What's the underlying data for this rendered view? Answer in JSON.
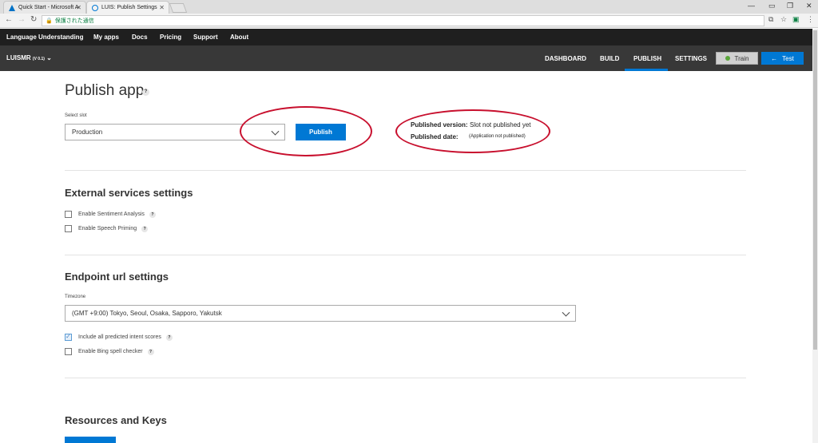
{
  "browser": {
    "tabs": [
      {
        "title": "Quick Start - Microsoft A",
        "active": false
      },
      {
        "title": "LUIS: Publish Settings",
        "active": true
      }
    ],
    "address": {
      "secure_label": "保護された通信",
      "url": ""
    }
  },
  "topnav": {
    "brand": "Language Understanding",
    "items": [
      "My apps",
      "Docs",
      "Pricing",
      "Support",
      "About"
    ]
  },
  "appbar": {
    "app_name": "LUISMR",
    "version": "(V 0.1)",
    "nav": [
      "DASHBOARD",
      "BUILD",
      "PUBLISH",
      "SETTINGS"
    ],
    "active_nav": "PUBLISH",
    "train_label": "Train",
    "test_label": "Test",
    "accent_color": "#0078d4",
    "train_status_color": "#5aa63a"
  },
  "publish": {
    "title": "Publish app",
    "help": "?",
    "slot_label": "Select slot",
    "slot_value": "Production",
    "publish_button": "Publish",
    "published_version_label": "Published version:",
    "published_version_value": "Slot not published yet",
    "published_date_label": "Published date:",
    "published_date_value": "(Application not published)"
  },
  "external_services": {
    "title": "External services settings",
    "options": [
      {
        "label": "Enable Sentiment Analysis",
        "checked": false
      },
      {
        "label": "Enable Speech Priming",
        "checked": false
      }
    ]
  },
  "endpoint": {
    "title": "Endpoint url settings",
    "timezone_label": "Timezone",
    "timezone_value": "(GMT +9:00) Tokyo, Seoul, Osaka, Sapporo, Yakutsk",
    "options": [
      {
        "label": "Include all predicted intent scores",
        "checked": true
      },
      {
        "label": "Enable Bing spell checker",
        "checked": false
      }
    ]
  },
  "resources": {
    "title": "Resources and Keys"
  },
  "annotation_color": "#c8102e"
}
